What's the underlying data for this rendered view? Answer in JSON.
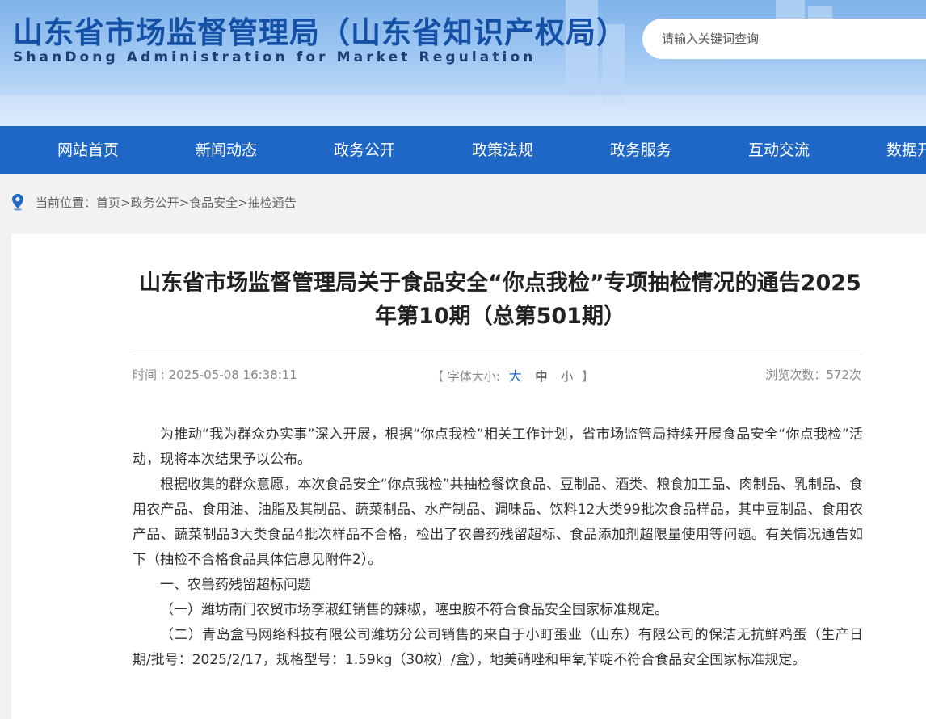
{
  "header": {
    "title": "山东省市场监督管理局（山东省知识产权局）",
    "subtitle": "ShanDong Administration for Market Regulation",
    "search_placeholder": "请输入关键词查询"
  },
  "nav": {
    "items": [
      "网站首页",
      "新闻动态",
      "政务公开",
      "政策法规",
      "政务服务",
      "互动交流",
      "数据开"
    ]
  },
  "breadcrumb": {
    "prefix": "当前位置：",
    "items": [
      "首页",
      "政务公开",
      "食品安全",
      "抽检通告"
    ],
    "separator": ">"
  },
  "article": {
    "title": "山东省市场监督管理局关于食品安全“你点我检”专项抽检情况的通告2025年第10期（总第501期）",
    "time": "时间 : 2025-05-08 16:38:11",
    "font_size": {
      "open": "【 字体大小:",
      "big": "大",
      "medium": "中",
      "small": "小",
      "close": "】"
    },
    "views": "浏览次数：572次",
    "paragraphs": [
      "为推动“我为群众办实事”深入开展，根据“你点我检”相关工作计划，省市场监管局持续开展食品安全“你点我检”活动，现将本次结果予以公布。",
      "根据收集的群众意愿，本次食品安全“你点我检”共抽检餐饮食品、豆制品、酒类、粮食加工品、肉制品、乳制品、食用农产品、食用油、油脂及其制品、蔬菜制品、水产制品、调味品、饮料12大类99批次食品样品，其中豆制品、食用农产品、蔬菜制品3大类食品4批次样品不合格，检出了农兽药残留超标、食品添加剂超限量使用等问题。有关情况通告如下（抽检不合格食品具体信息见附件2）。",
      "一、农兽药残留超标问题",
      "（一）潍坊南门农贸市场李淑红销售的辣椒，噻虫胺不符合食品安全国家标准规定。",
      "（二）青岛盒马网络科技有限公司潍坊分公司销售的来自于小町蛋业（山东）有限公司的保洁无抗鲜鸡蛋（生产日期/批号：2025/2/17，规格型号：1.59kg（30枚）/盒），地美硝唑和甲氧苄啶不符合食品安全国家标准规定。"
    ]
  },
  "colors": {
    "nav_bg": "#1f67c7",
    "title_blue": "#1450a6",
    "accent": "#1f67c7"
  }
}
